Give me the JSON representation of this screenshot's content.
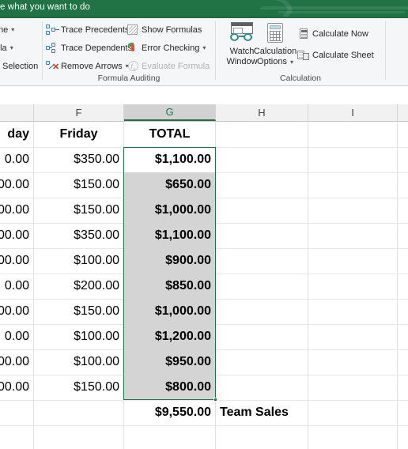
{
  "titlebar": {
    "tell_me": "e what you want to do",
    "background": "#217346"
  },
  "ribbon": {
    "groups": [
      {
        "name": "defined-names",
        "label": "",
        "commands": [
          {
            "label": "ne",
            "icon": "define-name-icon",
            "caret": "▾",
            "disabled": false
          },
          {
            "label": "ula",
            "icon": "use-in-formula-icon",
            "caret": "▾",
            "disabled": false
          },
          {
            "label": "Selection",
            "icon": "create-from-selection-icon",
            "caret": "",
            "disabled": false
          }
        ]
      },
      {
        "name": "formula-auditing",
        "label": "Formula Auditing",
        "commands": [
          {
            "label": "Trace Precedents",
            "icon": "trace-precedents-icon",
            "caret": "",
            "disabled": false
          },
          {
            "label": "Trace Dependents",
            "icon": "trace-dependents-icon",
            "caret": "",
            "disabled": false
          },
          {
            "label": "Remove Arrows",
            "icon": "remove-arrows-icon",
            "caret": "▾",
            "disabled": false
          },
          {
            "label": "Show Formulas",
            "icon": "show-formulas-icon",
            "caret": "",
            "disabled": false
          },
          {
            "label": "Error Checking",
            "icon": "error-checking-icon",
            "caret": "▾",
            "disabled": false
          },
          {
            "label": "Evaluate Formula",
            "icon": "evaluate-formula-icon",
            "caret": "",
            "disabled": true
          }
        ],
        "big_buttons": [
          {
            "line1": "Watch",
            "line2": "Window",
            "icon": "watch-window-icon",
            "caret": ""
          }
        ]
      },
      {
        "name": "calculation",
        "label": "Calculation",
        "big_buttons": [
          {
            "line1": "Calculation",
            "line2": "Options",
            "icon": "calculation-options-icon",
            "caret": "▾"
          }
        ],
        "commands": [
          {
            "label": "Calculate Now",
            "icon": "calculate-now-icon",
            "caret": "",
            "disabled": false
          },
          {
            "label": "Calculate Sheet",
            "icon": "calculate-sheet-icon",
            "caret": "",
            "disabled": false
          }
        ]
      }
    ]
  },
  "sheet": {
    "columns": [
      {
        "letter": "",
        "selected": false
      },
      {
        "letter": "F",
        "selected": false
      },
      {
        "letter": "G",
        "selected": true
      },
      {
        "letter": "H",
        "selected": false
      },
      {
        "letter": "I",
        "selected": false
      }
    ],
    "header_row": {
      "col_e": "day",
      "col_f": "Friday",
      "col_g": "TOTAL"
    },
    "rows": [
      {
        "col_e": "0.00",
        "col_f": "$350.00",
        "col_g": "$1,100.00",
        "active": true
      },
      {
        "col_e": "00.00",
        "col_f": "$150.00",
        "col_g": "$650.00",
        "active": false
      },
      {
        "col_e": "00.00",
        "col_f": "$150.00",
        "col_g": "$1,000.00",
        "active": false
      },
      {
        "col_e": "00.00",
        "col_f": "$350.00",
        "col_g": "$1,100.00",
        "active": false
      },
      {
        "col_e": "00.00",
        "col_f": "$100.00",
        "col_g": "$900.00",
        "active": false
      },
      {
        "col_e": "0.00",
        "col_f": "$200.00",
        "col_g": "$850.00",
        "active": false
      },
      {
        "col_e": "00.00",
        "col_f": "$150.00",
        "col_g": "$1,000.00",
        "active": false
      },
      {
        "col_e": "0.00",
        "col_f": "$100.00",
        "col_g": "$1,200.00",
        "active": false
      },
      {
        "col_e": "00.00",
        "col_f": "$100.00",
        "col_g": "$950.00",
        "active": false
      },
      {
        "col_e": "00.00",
        "col_f": "$150.00",
        "col_g": "$800.00",
        "active": false
      }
    ],
    "grand_total": {
      "value": "$9,550.00",
      "label": "Team Sales"
    },
    "selection": {
      "accent": "#217346",
      "fill": "#d4d4d4"
    }
  }
}
